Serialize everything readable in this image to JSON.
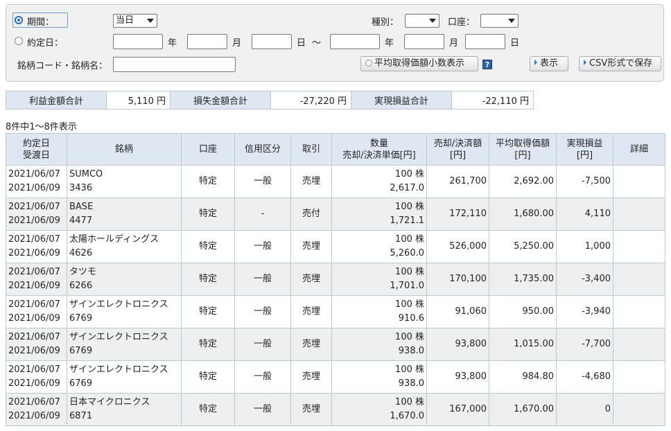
{
  "filter": {
    "period_label": "期間：",
    "period_value": "当日",
    "contract_label": "約定日：",
    "year_unit": "年",
    "month_unit": "月",
    "day_unit": "日",
    "range_sep": "〜",
    "type_label": "種別：",
    "account_label": "口座：",
    "code_label": "銘柄コード・銘柄名：",
    "avg_toggle_label": "平均取得価額小数表示",
    "show_button": "表示",
    "csv_button": "CSV形式で保存"
  },
  "summary": {
    "profit_label": "利益金額合計",
    "profit_value": "5,110 円",
    "loss_label": "損失金額合計",
    "loss_value": "-27,220 円",
    "realized_label": "実現損益合計",
    "realized_value": "-22,110 円"
  },
  "count_text": "8件中1〜8件表示",
  "table": {
    "headers": {
      "date1": "約定日",
      "date2": "受渡日",
      "stock": "銘柄",
      "account": "口座",
      "margin": "信用区分",
      "trade": "取引",
      "qty1": "数量",
      "qty2": "売却/決済単価[円]",
      "sell1": "売却/決済額",
      "sell2": "[円]",
      "avg1": "平均取得価額",
      "avg2": "[円]",
      "pl1": "実現損益",
      "pl2": "[円]",
      "detail": "詳細"
    },
    "rows": [
      {
        "contract": "2021/06/07",
        "delivery": "2021/06/09",
        "name": "SUMCO",
        "code": "3436",
        "account": "特定",
        "margin": "一般",
        "trade": "売埋",
        "qty": "100 株",
        "price": "2,617.0",
        "amount": "261,700",
        "avg": "2,692.00",
        "pl": "-7,500"
      },
      {
        "contract": "2021/06/07",
        "delivery": "2021/06/09",
        "name": "BASE",
        "code": "4477",
        "account": "特定",
        "margin": "-",
        "trade": "売付",
        "qty": "100 株",
        "price": "1,721.1",
        "amount": "172,110",
        "avg": "1,680.00",
        "pl": "4,110"
      },
      {
        "contract": "2021/06/07",
        "delivery": "2021/06/09",
        "name": "太陽ホールディングス",
        "code": "4626",
        "account": "特定",
        "margin": "一般",
        "trade": "売埋",
        "qty": "100 株",
        "price": "5,260.0",
        "amount": "526,000",
        "avg": "5,250.00",
        "pl": "1,000"
      },
      {
        "contract": "2021/06/07",
        "delivery": "2021/06/09",
        "name": "タツモ",
        "code": "6266",
        "account": "特定",
        "margin": "一般",
        "trade": "売埋",
        "qty": "100 株",
        "price": "1,701.0",
        "amount": "170,100",
        "avg": "1,735.00",
        "pl": "-3,400"
      },
      {
        "contract": "2021/06/07",
        "delivery": "2021/06/09",
        "name": "ザインエレクトロニクス",
        "code": "6769",
        "account": "特定",
        "margin": "一般",
        "trade": "売埋",
        "qty": "100 株",
        "price": "910.6",
        "amount": "91,060",
        "avg": "950.00",
        "pl": "-3,940"
      },
      {
        "contract": "2021/06/07",
        "delivery": "2021/06/09",
        "name": "ザインエレクトロニクス",
        "code": "6769",
        "account": "特定",
        "margin": "一般",
        "trade": "売埋",
        "qty": "100 株",
        "price": "938.0",
        "amount": "93,800",
        "avg": "1,015.00",
        "pl": "-7,700"
      },
      {
        "contract": "2021/06/07",
        "delivery": "2021/06/09",
        "name": "ザインエレクトロニクス",
        "code": "6769",
        "account": "特定",
        "margin": "一般",
        "trade": "売埋",
        "qty": "100 株",
        "price": "938.0",
        "amount": "93,800",
        "avg": "984.80",
        "pl": "-4,680"
      },
      {
        "contract": "2021/06/07",
        "delivery": "2021/06/09",
        "name": "日本マイクロニクス",
        "code": "6871",
        "account": "特定",
        "margin": "一般",
        "trade": "売埋",
        "qty": "100 株",
        "price": "1,670.0",
        "amount": "167,000",
        "avg": "1,670.00",
        "pl": "0"
      }
    ]
  }
}
